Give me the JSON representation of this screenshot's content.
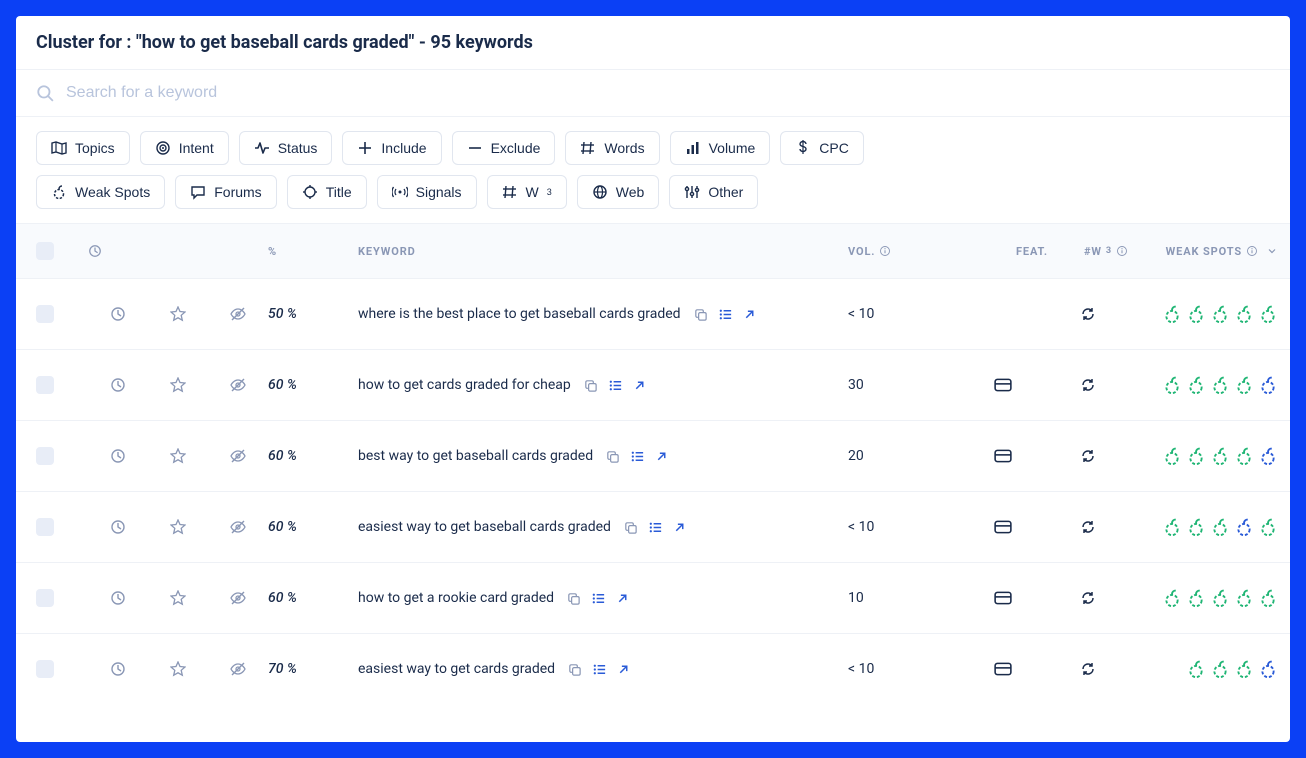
{
  "header": {
    "title": "Cluster for : \"how to get baseball cards graded\" - 95 keywords"
  },
  "search": {
    "placeholder": "Search for a keyword"
  },
  "filters": [
    {
      "icon": "map",
      "label": "Topics"
    },
    {
      "icon": "target",
      "label": "Intent"
    },
    {
      "icon": "activity",
      "label": "Status"
    },
    {
      "icon": "plus",
      "label": "Include"
    },
    {
      "icon": "minus",
      "label": "Exclude"
    },
    {
      "icon": "hash",
      "label": "Words"
    },
    {
      "icon": "bars",
      "label": "Volume"
    },
    {
      "icon": "dollar",
      "label": "CPC"
    },
    {
      "icon": "fruit",
      "label": "Weak Spots"
    },
    {
      "icon": "chat",
      "label": "Forums"
    },
    {
      "icon": "circle-focus",
      "label": "Title"
    },
    {
      "icon": "signal",
      "label": "Signals"
    },
    {
      "icon": "hashsup",
      "label": "W",
      "sup": "3"
    },
    {
      "icon": "globe",
      "label": "Web"
    },
    {
      "icon": "sliders",
      "label": "Other"
    }
  ],
  "columns": {
    "pct": "%",
    "keyword": "KEYWORD",
    "vol": "VOL.",
    "feat": "FEAT.",
    "w3": "#W",
    "w3sup": "3",
    "weak": "WEAK SPOTS"
  },
  "rows": [
    {
      "pct": "50 %",
      "keyword": "where is the best place to get baseball cards graded",
      "vol": "< 10",
      "feat": "",
      "spots": [
        "g",
        "g",
        "g",
        "g",
        "g"
      ]
    },
    {
      "pct": "60 %",
      "keyword": "how to get cards graded for cheap",
      "vol": "30",
      "feat": "card",
      "spots": [
        "g",
        "g",
        "g",
        "g",
        "b"
      ]
    },
    {
      "pct": "60 %",
      "keyword": "best way to get baseball cards graded",
      "vol": "20",
      "feat": "card",
      "spots": [
        "g",
        "g",
        "g",
        "g",
        "b"
      ]
    },
    {
      "pct": "60 %",
      "keyword": "easiest way to get baseball cards graded",
      "vol": "< 10",
      "feat": "card",
      "spots": [
        "g",
        "g",
        "g",
        "b",
        "g"
      ]
    },
    {
      "pct": "60 %",
      "keyword": "how to get a rookie card graded",
      "vol": "10",
      "feat": "card",
      "spots": [
        "g",
        "g",
        "g",
        "g",
        "g"
      ]
    },
    {
      "pct": "70 %",
      "keyword": "easiest way to get cards graded",
      "vol": "< 10",
      "feat": "card",
      "spots": [
        "g",
        "g",
        "g",
        "b"
      ]
    }
  ],
  "colors": {
    "green": "#1fb574",
    "blue": "#2a5bd7"
  }
}
